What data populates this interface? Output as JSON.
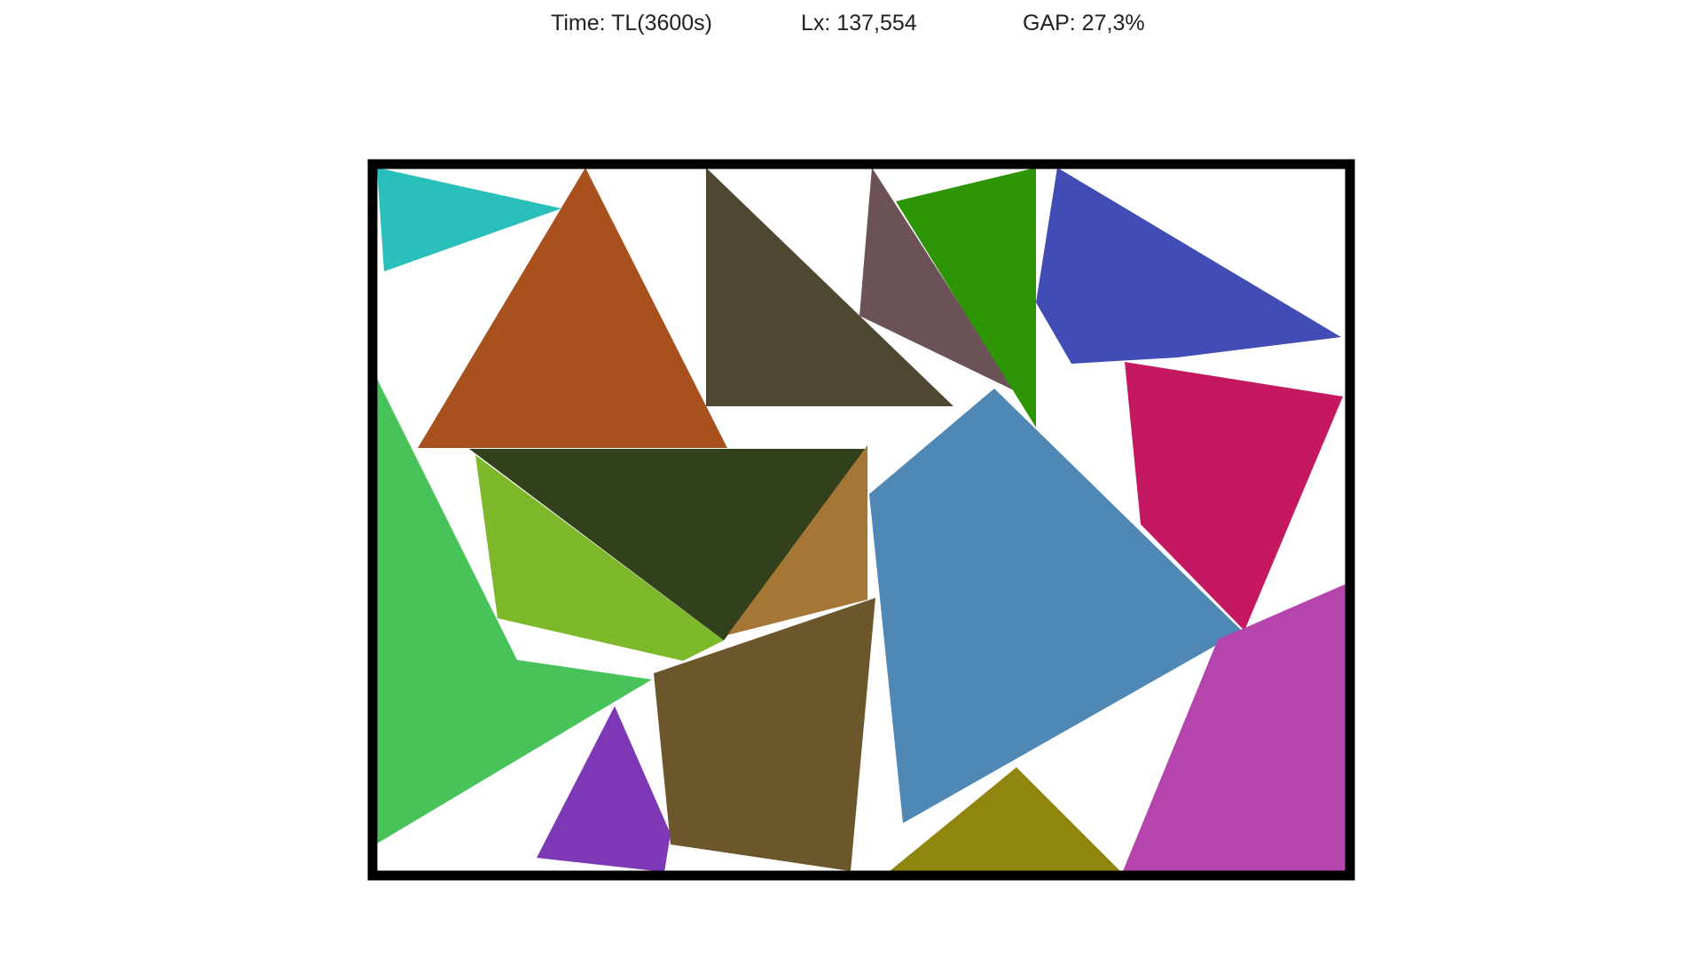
{
  "header": {
    "time": "Time: TL(3600s)",
    "lx": "Lx: 137,554",
    "gap": "GAP: 27,3%"
  },
  "board": {
    "border_color": "#000000",
    "background": "#ffffff"
  },
  "pieces": [
    {
      "name": "teal-triangle",
      "color": "#2abfba"
    },
    {
      "name": "rust-triangle",
      "color": "#a8511e"
    },
    {
      "name": "olive-dark-triangle",
      "color": "#4e4833"
    },
    {
      "name": "mauve-triangle",
      "color": "#6a5257"
    },
    {
      "name": "green-triangle",
      "color": "#2e9606"
    },
    {
      "name": "blue-quad",
      "color": "#414cb4"
    },
    {
      "name": "magenta-quad",
      "color": "#c41862"
    },
    {
      "name": "dark-green-triangle",
      "color": "#32411b"
    },
    {
      "name": "lime-triangle",
      "color": "#7db72a"
    },
    {
      "name": "light-green-piece",
      "color": "#48c35a"
    },
    {
      "name": "tan-triangle",
      "color": "#a57636"
    },
    {
      "name": "steel-blue-quad",
      "color": "#4f87b5"
    },
    {
      "name": "brown-quad",
      "color": "#6b572b"
    },
    {
      "name": "purple-triangle",
      "color": "#7e38b5"
    },
    {
      "name": "olive-triangle",
      "color": "#8f850f"
    },
    {
      "name": "orchid-quad",
      "color": "#b545ad"
    }
  ]
}
